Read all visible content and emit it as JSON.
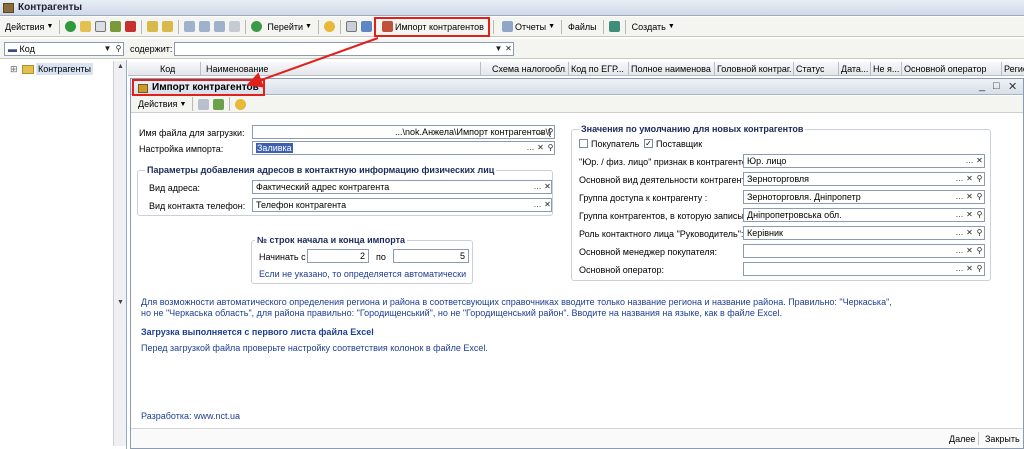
{
  "window": {
    "title": "Контрагенты"
  },
  "toolbar": {
    "actions_label": "Действия",
    "goto_label": "Перейти",
    "import_label": "Импорт контрагентов",
    "reports_label": "Отчеты",
    "files_label": "Файлы",
    "create_label": "Создать"
  },
  "filter": {
    "field_value": "Код",
    "contains_label": "содержит:",
    "contains_value": ""
  },
  "tree": {
    "root_label": "Контрагенты"
  },
  "list": {
    "columns": [
      "Код",
      "Наименование",
      "Схема налогообл...",
      "Код по ЕГР...",
      "Полное наименова...",
      "Головной контраг...",
      "Статус",
      "Дата...",
      "Не я...",
      "Основной оператор",
      "Регис"
    ]
  },
  "dialog": {
    "title": "Импорт контрагентов",
    "actions_label": "Действия",
    "file_label": "Имя файла для загрузки:",
    "file_value": "...\\nok.Анжела\\Импорт контрагентов\\(",
    "setting_label": "Настройка импорта:",
    "setting_value": "Заливка",
    "addr_group_title": "Параметры добавления адресов в контактную информацию физических лиц",
    "addr_type_label": "Вид адреса:",
    "addr_type_value": "Фактический адрес контрагента",
    "phone_type_label": "Вид контакта телефон:",
    "phone_type_value": "Телефон контрагента",
    "rows_group_title": "№ строк начала и конца импорта",
    "start_label": "Начинать с",
    "start_value": "2",
    "to_label": "по",
    "end_value": "5",
    "rows_hint": "Если не указано, то определяется автоматически",
    "defaults_group_title": "Значения по умолчанию для новых контрагентов",
    "buyer_label": "Покупатель",
    "buyer_checked": false,
    "supplier_label": "Поставщик",
    "supplier_checked": true,
    "ur_label": "\"Юр. / физ. лицо\" признак в контрагенте:",
    "ur_value": "Юр. лицо",
    "activity_label": "Основной вид деятельности контрагент...",
    "activity_value": "Зерноторговля",
    "access_label": "Группа доступа к контрагенту :",
    "access_value": "Зерноторговля. Дніпропетр",
    "group_label": "Группа контрагентов, в которую записы...",
    "group_value": "Дніпропетровська обл.",
    "role_label": "Роль контактного лица \"Руководитель\":",
    "role_value": "Керівник",
    "manager_label": "Основной менеджер покупателя:",
    "manager_value": "",
    "operator_label": "Основной оператор:",
    "operator_value": "",
    "note_line1": "Для возможности автоматического определения региона и района в соответсвующих справочниках вводите только название региона и название района. Правильно: \"Черкаська\",",
    "note_line2": "но не \"Черкаська область\", для района правильно: \"Городищенський\", но не \"Городищенський район\". Вводите на названия на языке, как в файле Excel.",
    "bold_note": "Загрузка выполняется с первого листа файла Excel",
    "check_note": "Перед загрузкой файла проверьте настройку соответствия колонок в файле Excel.",
    "dev_link": "Разработка: www.nct.ua",
    "next_label": "Далее",
    "close_label": "Закрыть"
  },
  "colors": {
    "highlight": "#e0201a",
    "group_title": "#1a2a5a",
    "link": "#1d3e91"
  }
}
